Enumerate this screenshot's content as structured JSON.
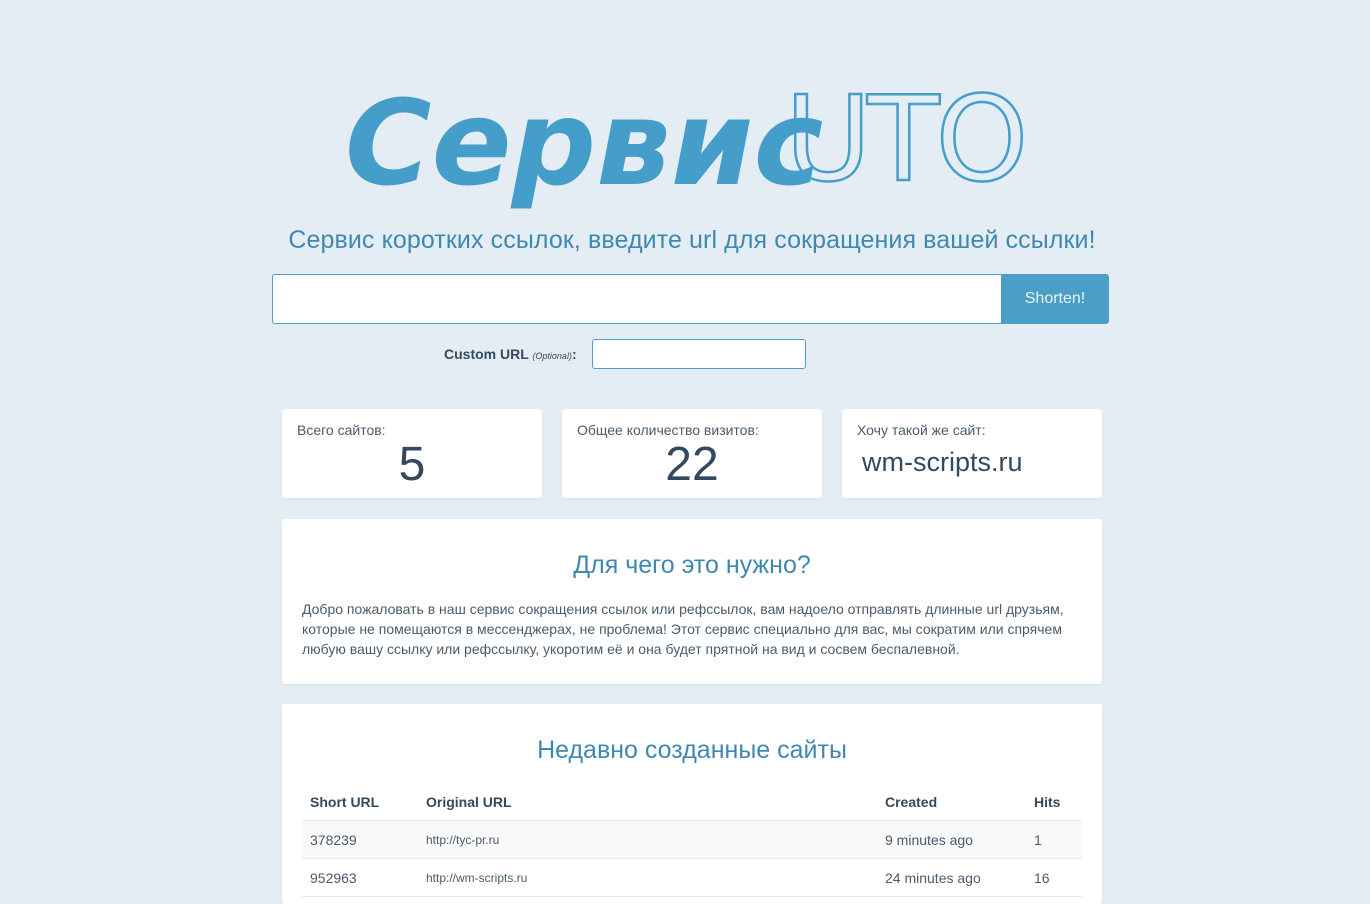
{
  "logo": {
    "part1": "Сервис",
    "part2": "UTO"
  },
  "subtitle": "Сервис коротких ссылок, введите url для сокращения вашей ссылки!",
  "shorten_form": {
    "url_value": "",
    "button_label": "Shorten!"
  },
  "custom_url": {
    "label": "Custom URL",
    "optional": "(Optional)",
    "colon": ":",
    "value": ""
  },
  "stats": {
    "total_sites_label": "Всего сайтов:",
    "total_sites_value": "5",
    "total_visits_label": "Общее количество визитов:",
    "total_visits_value": "22",
    "want_site_label": "Хочу такой же сайт:",
    "want_site_link": "wm-scripts.ru"
  },
  "about": {
    "title": "Для чего это нужно?",
    "text": "Добро пожаловать в наш сервис сокращения ссылок или рефссылок, вам надоело отправлять длинные url друзьям, которые не помещаются в мессенджерах, не проблема! Этот сервис специально для вас, мы сократим или спрячем любую вашу ссылку или рефссылку, укоротим её и она будет прятной на вид и сосвем беспалевной."
  },
  "recent": {
    "title": "Недавно созданные сайты",
    "columns": [
      "Short URL",
      "Original URL",
      "Created",
      "Hits"
    ],
    "rows": [
      [
        "378239",
        "http://tyc-pr.ru",
        "9 minutes ago",
        "1"
      ],
      [
        "952963",
        "http://wm-scripts.ru",
        "24 minutes ago",
        "16"
      ]
    ]
  },
  "colors": {
    "background": "#e4edf4",
    "accent": "#4b9fc7",
    "heading": "#3f88b0",
    "text": "#34495e"
  }
}
